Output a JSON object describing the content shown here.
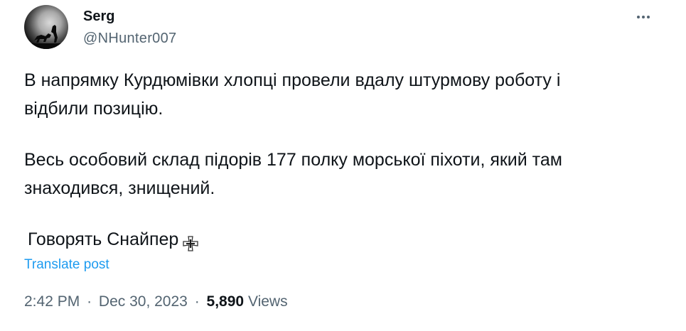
{
  "author": {
    "display_name": "Serg",
    "handle": "@NHunter007"
  },
  "tweet": {
    "paragraph_1": "В напрямку Курдюмівки хлопці провели вдалу штурмову роботу і\nвідбили позицію.",
    "paragraph_2": "Весь особовий склад підорів 177 полку морської піхоти, який там\nзнаходився, знищений.",
    "paragraph_3": "Говорять Снайпер"
  },
  "translate_label": "Translate post",
  "meta": {
    "time": "2:42 PM",
    "separator": "·",
    "date": "Dec 30, 2023",
    "views_count": "5,890",
    "views_label": "Views"
  },
  "icons": {
    "more": "more-horizontal-icon",
    "cross": "iron-cross-icon"
  },
  "colors": {
    "text_primary": "#0f1419",
    "text_secondary": "#536471",
    "link": "#1d9bf0"
  }
}
